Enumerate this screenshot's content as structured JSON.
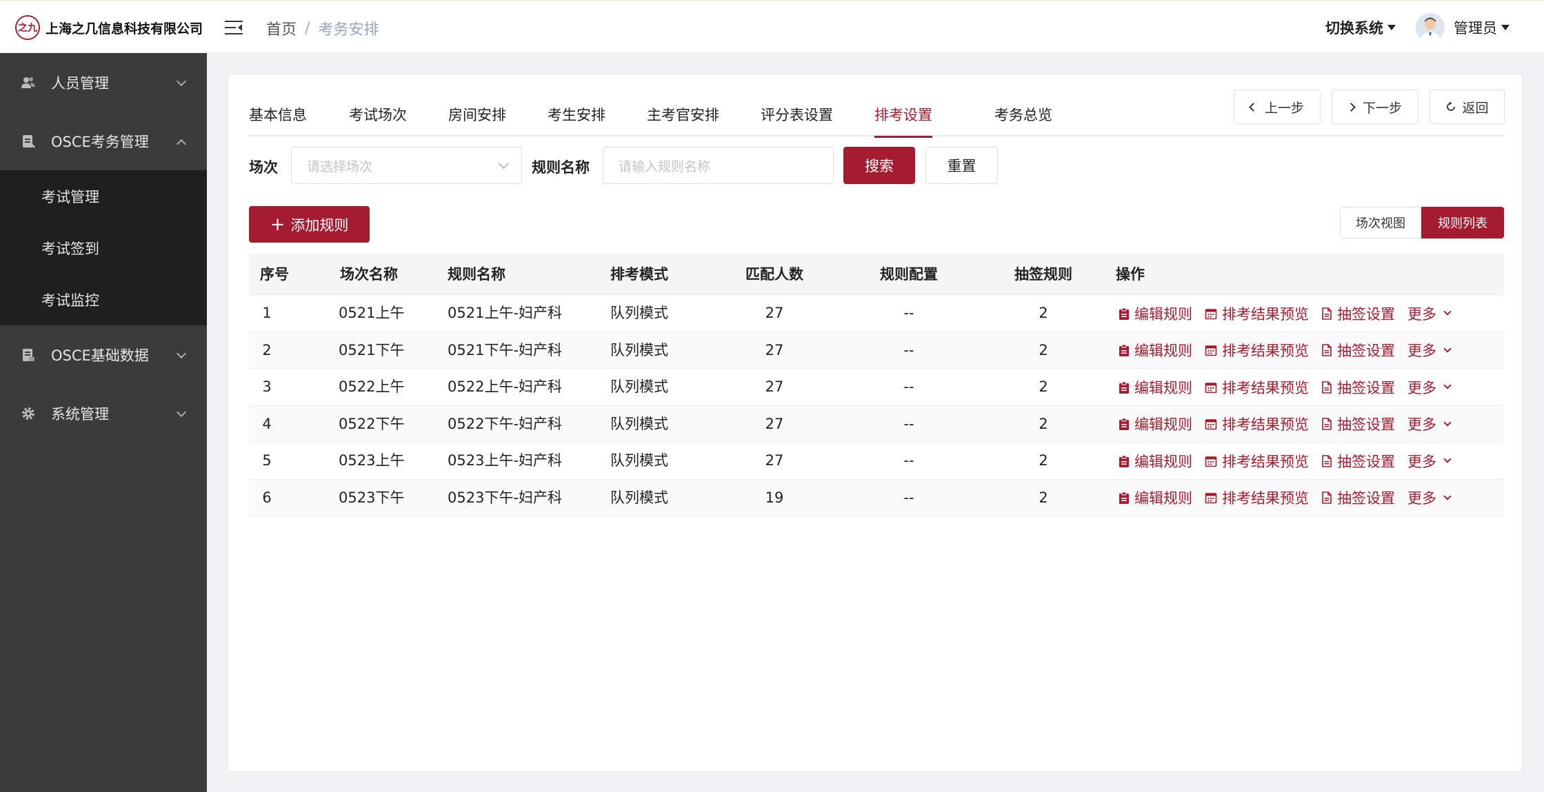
{
  "header": {
    "company": "上海之几信息科技有限公司",
    "logo_text": "之九",
    "breadcrumb": [
      "首页",
      "考务安排"
    ],
    "breadcrumb_sep": "/",
    "switch_system": "切换系统",
    "user": "管理员"
  },
  "sidebar": {
    "items": [
      {
        "label": "人员管理",
        "icon": "users-icon",
        "expanded": false
      },
      {
        "label": "OSCE考务管理",
        "icon": "clipboard-icon",
        "expanded": true
      },
      {
        "label": "OSCE基础数据",
        "icon": "database-icon",
        "expanded": false
      },
      {
        "label": "系统管理",
        "icon": "gear-icon",
        "expanded": false
      }
    ],
    "subitems": [
      "考试管理",
      "考试签到",
      "考试监控"
    ]
  },
  "tabs": [
    "基本信息",
    "考试场次",
    "房间安排",
    "考生安排",
    "主考官安排",
    "评分表设置",
    "排考设置",
    "考务总览"
  ],
  "active_tab": "排考设置",
  "steps": {
    "prev": "上一步",
    "next": "下一步",
    "back": "返回"
  },
  "filters": {
    "session_label": "场次",
    "session_placeholder": "请选择场次",
    "rule_label": "规则名称",
    "rule_placeholder": "请输入规则名称",
    "search": "搜索",
    "reset": "重置"
  },
  "add_rule": "添加规则",
  "view_toggle": {
    "session_view": "场次视图",
    "rule_list": "规则列表",
    "active": "规则列表"
  },
  "table": {
    "columns": [
      "序号",
      "场次名称",
      "规则名称",
      "排考模式",
      "匹配人数",
      "规则配置",
      "抽签规则",
      "操作"
    ],
    "rows": [
      {
        "no": "1",
        "session": "0521上午",
        "rule": "0521上午-妇产科",
        "mode": "队列模式",
        "count": "27",
        "config": "--",
        "draw": "2"
      },
      {
        "no": "2",
        "session": "0521下午",
        "rule": "0521下午-妇产科",
        "mode": "队列模式",
        "count": "27",
        "config": "--",
        "draw": "2"
      },
      {
        "no": "3",
        "session": "0522上午",
        "rule": "0522上午-妇产科",
        "mode": "队列模式",
        "count": "27",
        "config": "--",
        "draw": "2"
      },
      {
        "no": "4",
        "session": "0522下午",
        "rule": "0522下午-妇产科",
        "mode": "队列模式",
        "count": "27",
        "config": "--",
        "draw": "2"
      },
      {
        "no": "5",
        "session": "0523上午",
        "rule": "0523上午-妇产科",
        "mode": "队列模式",
        "count": "27",
        "config": "--",
        "draw": "2"
      },
      {
        "no": "6",
        "session": "0523下午",
        "rule": "0523下午-妇产科",
        "mode": "队列模式",
        "count": "19",
        "config": "--",
        "draw": "2"
      }
    ],
    "actions": {
      "edit": "编辑规则",
      "preview": "排考结果预览",
      "draw": "抽签设置",
      "more": "更多"
    }
  },
  "colors": {
    "accent": "#a51c30",
    "sidebar": "#3b3b3b",
    "submenu": "#1f1f1f"
  }
}
